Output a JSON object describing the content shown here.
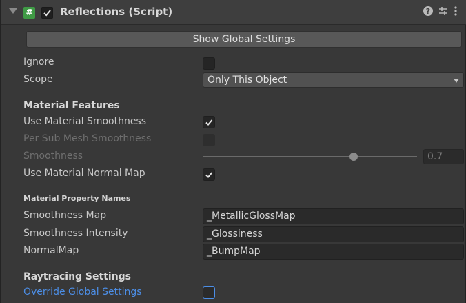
{
  "component": {
    "title": "Reflections (Script)",
    "script_icon": "#",
    "enabled": true,
    "icons": [
      "help-icon",
      "presets-icon",
      "kebab-menu-icon"
    ]
  },
  "buttons": {
    "show_global_settings": "Show Global Settings"
  },
  "fields": {
    "ignore": {
      "label": "Ignore",
      "checked": false
    },
    "scope": {
      "label": "Scope",
      "value": "Only This Object"
    }
  },
  "material_features": {
    "heading": "Material Features",
    "use_material_smoothness": {
      "label": "Use Material Smoothness",
      "checked": true
    },
    "per_sub_mesh_smoothness": {
      "label": "Per Sub Mesh Smoothness",
      "checked": false,
      "disabled": true
    },
    "smoothness": {
      "label": "Smoothness",
      "value": "0.7",
      "disabled": true
    },
    "use_material_normal_map": {
      "label": "Use Material Normal Map",
      "checked": true
    }
  },
  "material_property_names": {
    "heading": "Material Property Names",
    "smoothness_map": {
      "label": "Smoothness Map",
      "value": "_MetallicGlossMap"
    },
    "smoothness_intensity": {
      "label": "Smoothness Intensity",
      "value": "_Glossiness"
    },
    "normal_map": {
      "label": "NormalMap",
      "value": "_BumpMap"
    }
  },
  "raytracing": {
    "heading": "Raytracing Settings",
    "override_global_settings": {
      "label": "Override Global Settings",
      "checked": false
    }
  },
  "colors": {
    "accent_blue": "#4c8ee6",
    "script_icon_green": "#3f9a45"
  }
}
